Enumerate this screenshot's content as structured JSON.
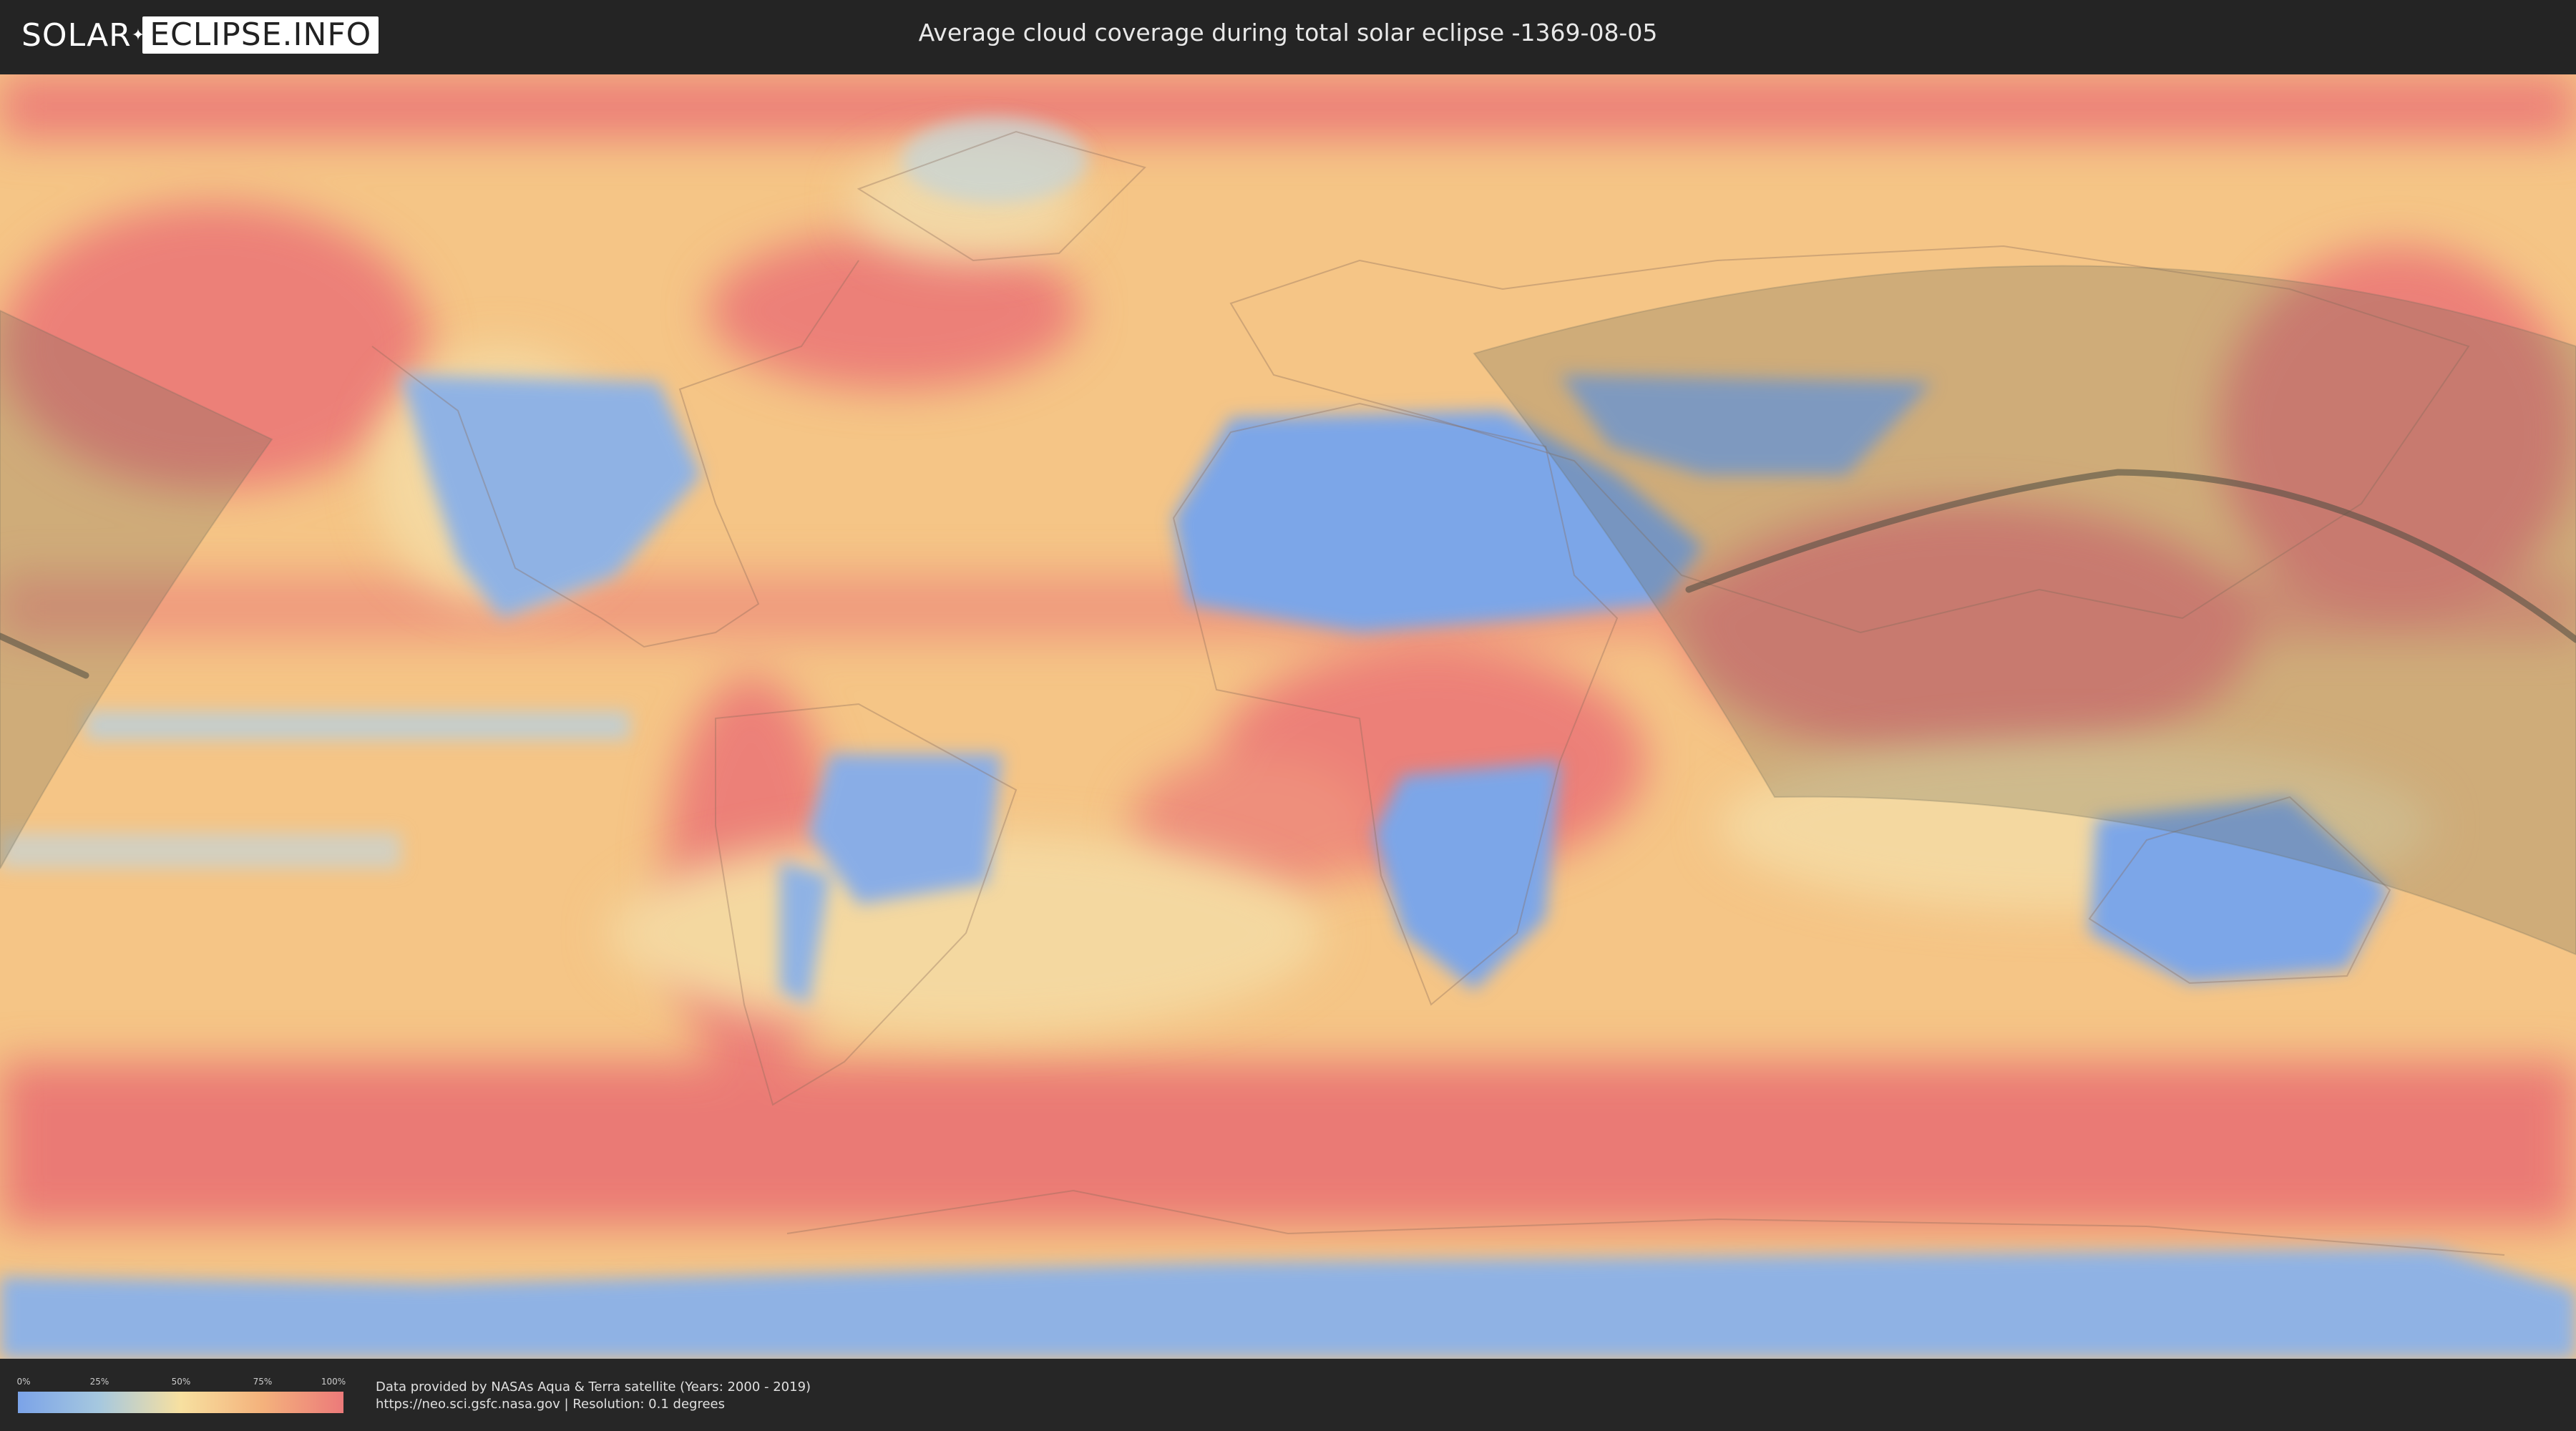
{
  "header": {
    "logo_left": "SOLAR",
    "logo_right": "ECLIPSE.INFO",
    "title": "Average cloud coverage during total solar eclipse -1369-08-05"
  },
  "legend": {
    "ticks": [
      "0%",
      "25%",
      "50%",
      "75%",
      "100%"
    ],
    "colors": [
      "#7ba3e8",
      "#a6c8df",
      "#f7e0a0",
      "#f4b27c",
      "#ec7a7a"
    ]
  },
  "credits": {
    "line1": "Data provided by NASAs Aqua & Terra satellite (Years: 2000 - 2019)",
    "line2": "https://neo.sci.gsfc.nasa.gov | Resolution: 0.1 degrees"
  },
  "map": {
    "palette": {
      "clear": "#7ba3e8",
      "light": "#a6c8df",
      "medium": "#f7e0a0",
      "heavy": "#f4b27c",
      "overcast": "#ec7a7a",
      "eclipse_zone": "#6b6b5a",
      "eclipse_path": "#4a4a40"
    }
  }
}
